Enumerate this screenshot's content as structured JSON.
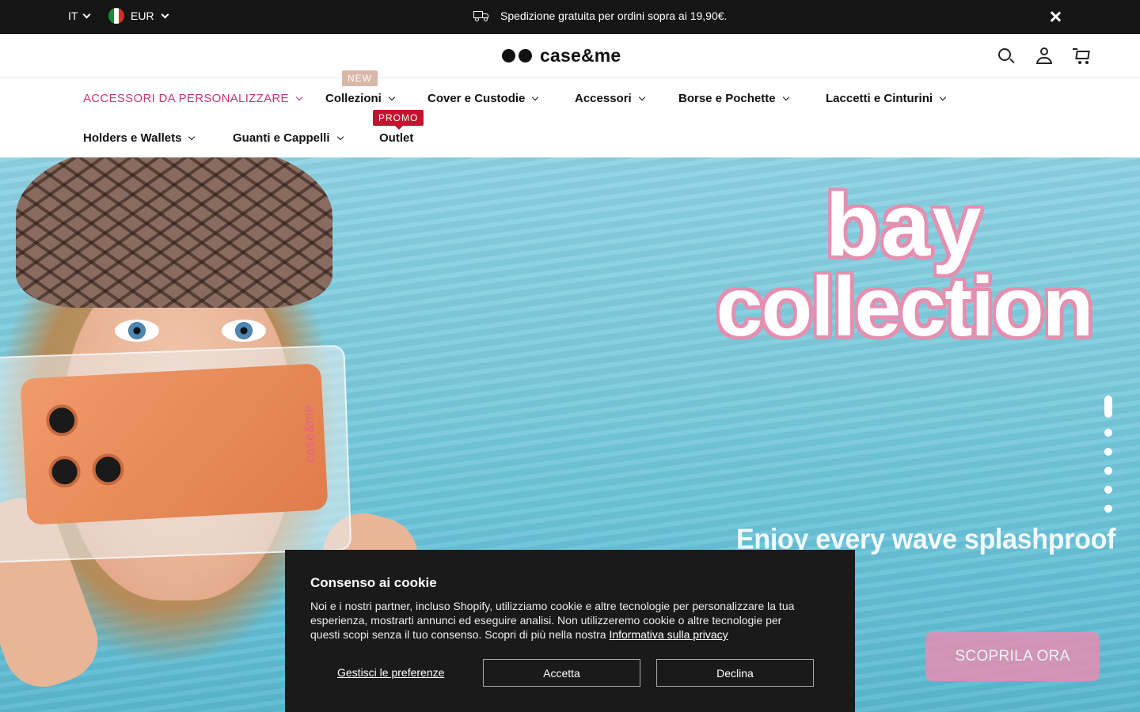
{
  "topbar": {
    "language": "IT",
    "currency": "EUR",
    "announcement": "Spedizione gratuita per ordini sopra ai 19,90€."
  },
  "header": {
    "logo_text": "case&me"
  },
  "nav": {
    "items": [
      {
        "label": "ACCESSORI DA PERSONALIZZARE"
      },
      {
        "label": "Collezioni",
        "badge": "NEW"
      },
      {
        "label": "Cover e Custodie"
      },
      {
        "label": "Accessori"
      },
      {
        "label": "Borse e Pochette"
      },
      {
        "label": "Laccetti e Cinturini"
      },
      {
        "label": "Holders e Wallets"
      },
      {
        "label": "Guanti e Cappelli"
      },
      {
        "label": "Outlet",
        "badge": "PROMO"
      }
    ]
  },
  "hero": {
    "headline_line1": "bay",
    "headline_line2": "collection",
    "tagline": "Enjoy every wave splashproof",
    "cta_label": "SCOPRILA ORA",
    "phone_brand": "case&me",
    "slides_total": 6,
    "active_slide": 1
  },
  "cookie": {
    "title": "Consenso ai cookie",
    "text": "Noi e i nostri partner, incluso Shopify, utilizziamo cookie e altre tecnologie per personalizzare la tua esperienza, mostrarti annunci ed eseguire analisi. Non utilizzeremo cookie o altre tecnologie per questi scopi senza il tuo consenso. Scopri di più nella nostra ",
    "privacy_link": "Informativa sulla privacy",
    "preferences_label": "Gestisci le preferenze",
    "accept_label": "Accetta",
    "decline_label": "Declina"
  },
  "colors": {
    "topbar_bg": "#161616",
    "nav_accent": "#c7357a",
    "badge_new": "#d9b7a8",
    "badge_promo": "#c4122f",
    "cta_pink": "#e48eb0",
    "cookie_bg": "#1a1a1a"
  },
  "icons": [
    "chevron-down-icon",
    "italy-flag-icon",
    "truck-icon",
    "close-icon",
    "search-icon",
    "user-icon",
    "cart-icon"
  ]
}
